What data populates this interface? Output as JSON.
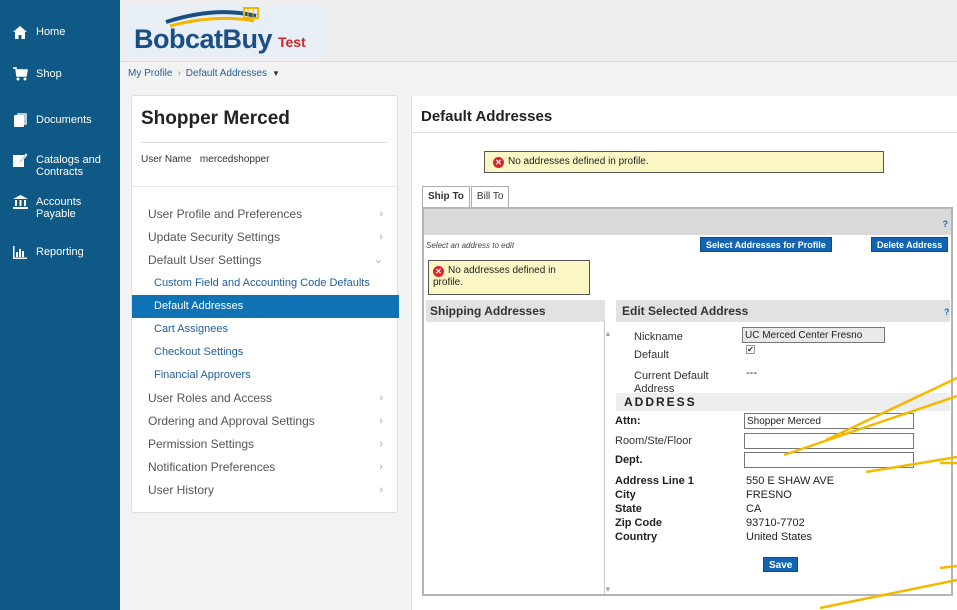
{
  "nav": {
    "items": [
      {
        "label": "Home",
        "icon": "home-icon"
      },
      {
        "label": "Shop",
        "icon": "cart-icon"
      },
      {
        "label": "Documents",
        "icon": "documents-icon"
      },
      {
        "label": "Catalogs and Contracts",
        "icon": "catalog-icon"
      },
      {
        "label": "Accounts Payable",
        "icon": "bank-icon"
      },
      {
        "label": "Reporting",
        "icon": "chart-icon"
      }
    ]
  },
  "header": {
    "logo_word": "BobcatBuy",
    "logo_tag": "Test"
  },
  "breadcrumb": {
    "first": "My Profile",
    "current": "Default Addresses"
  },
  "profile": {
    "name": "Shopper Merced",
    "username_label": "User Name",
    "username": "mercedshopper",
    "menu": [
      {
        "label": "User Profile and Preferences",
        "type": "top",
        "chev": "›"
      },
      {
        "label": "Update Security Settings",
        "type": "top",
        "chev": "›"
      },
      {
        "label": "Default User Settings",
        "type": "top",
        "chev": "⌄"
      },
      {
        "label": "Custom Field and Accounting Code Defaults",
        "type": "sub"
      },
      {
        "label": "Default Addresses",
        "type": "sub-active"
      },
      {
        "label": "Cart Assignees",
        "type": "sub"
      },
      {
        "label": "Checkout Settings",
        "type": "sub"
      },
      {
        "label": "Financial Approvers",
        "type": "sub"
      },
      {
        "label": "User Roles and Access",
        "type": "top",
        "chev": "›"
      },
      {
        "label": "Ordering and Approval Settings",
        "type": "top",
        "chev": "›"
      },
      {
        "label": "Permission Settings",
        "type": "top",
        "chev": "›"
      },
      {
        "label": "Notification Preferences",
        "type": "top",
        "chev": "›"
      },
      {
        "label": "User History",
        "type": "top",
        "chev": "›"
      }
    ]
  },
  "main": {
    "title": "Default Addresses",
    "warning": "No addresses defined in profile.",
    "tabs": [
      "Ship To",
      "Bill To"
    ],
    "help": "?",
    "hint": "Select an address to edit",
    "select_btn": "Select Addresses for Profile",
    "delete_btn": "Delete Address",
    "warning2": "No addresses defined in profile.",
    "shipping_header": "Shipping Addresses",
    "edit_header": "Edit Selected Address",
    "fields": {
      "nickname_label": "Nickname",
      "nickname_value": "UC Merced Center Fresno",
      "default_label": "Default",
      "current_default_label": "Current Default Address",
      "current_default_value": "---",
      "address_header": "ADDRESS",
      "attn_label": "Attn:",
      "attn_value": "Shopper Merced",
      "room_label": "Room/Ste/Floor",
      "room_value": "",
      "dept_label": "Dept.",
      "dept_value": "",
      "line1_label": "Address Line 1",
      "line1_value": "550 E SHAW AVE",
      "city_label": "City",
      "city_value": "FRESNO",
      "state_label": "State",
      "state_value": "CA",
      "zip_label": "Zip Code",
      "zip_value": "93710-7702",
      "country_label": "Country",
      "country_value": "United States"
    },
    "save_btn": "Save"
  },
  "colors": {
    "nav_bg": "#0f5987",
    "active_menu": "#0e72b5",
    "button": "#1464b4",
    "warning_bg": "#fbf7c4",
    "annotation": "#f5b800"
  }
}
